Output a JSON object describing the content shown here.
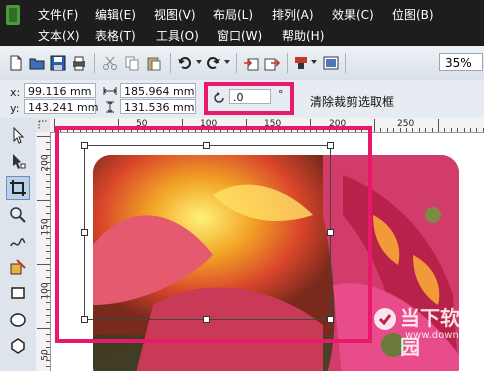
{
  "menu": {
    "row1": [
      {
        "label": "文件(F)"
      },
      {
        "label": "编辑(E)"
      },
      {
        "label": "视图(V)"
      },
      {
        "label": "布局(L)"
      },
      {
        "label": "排列(A)"
      },
      {
        "label": "效果(C)"
      },
      {
        "label": "位图(B)"
      }
    ],
    "row2": [
      {
        "label": "文本(X)"
      },
      {
        "label": "表格(T)"
      },
      {
        "label": "工具(O)"
      },
      {
        "label": "窗口(W)"
      },
      {
        "label": "帮助(H)"
      }
    ]
  },
  "toolbar": {
    "zoom_value": "35%",
    "icons": [
      "new-document-icon",
      "open-icon",
      "save-icon",
      "print-icon",
      "cut-icon",
      "copy-icon",
      "paste-icon",
      "undo-icon",
      "redo-icon",
      "import-icon",
      "export-icon",
      "application-launcher-icon",
      "welcome-screen-icon"
    ]
  },
  "property_bar": {
    "x_label": "x:",
    "x_value": "99.116 mm",
    "y_label": "y:",
    "y_value": "143.241 mm",
    "width_value": "185.964 mm",
    "height_value": "131.536 mm",
    "rotation_value": ".0",
    "degree_symbol": "°",
    "clear_crop_label": "清除裁剪选取框"
  },
  "rulers": {
    "horizontal_labels": [
      "50",
      "100",
      "150",
      "200",
      "250"
    ],
    "vertical_labels": [
      "200",
      "150",
      "100",
      "50"
    ]
  },
  "watermark": {
    "text": "当下软件园",
    "url": "www.downxia.com"
  },
  "colors": {
    "highlight": "#e8196b",
    "menubar_bg": "#1d1d1d"
  }
}
